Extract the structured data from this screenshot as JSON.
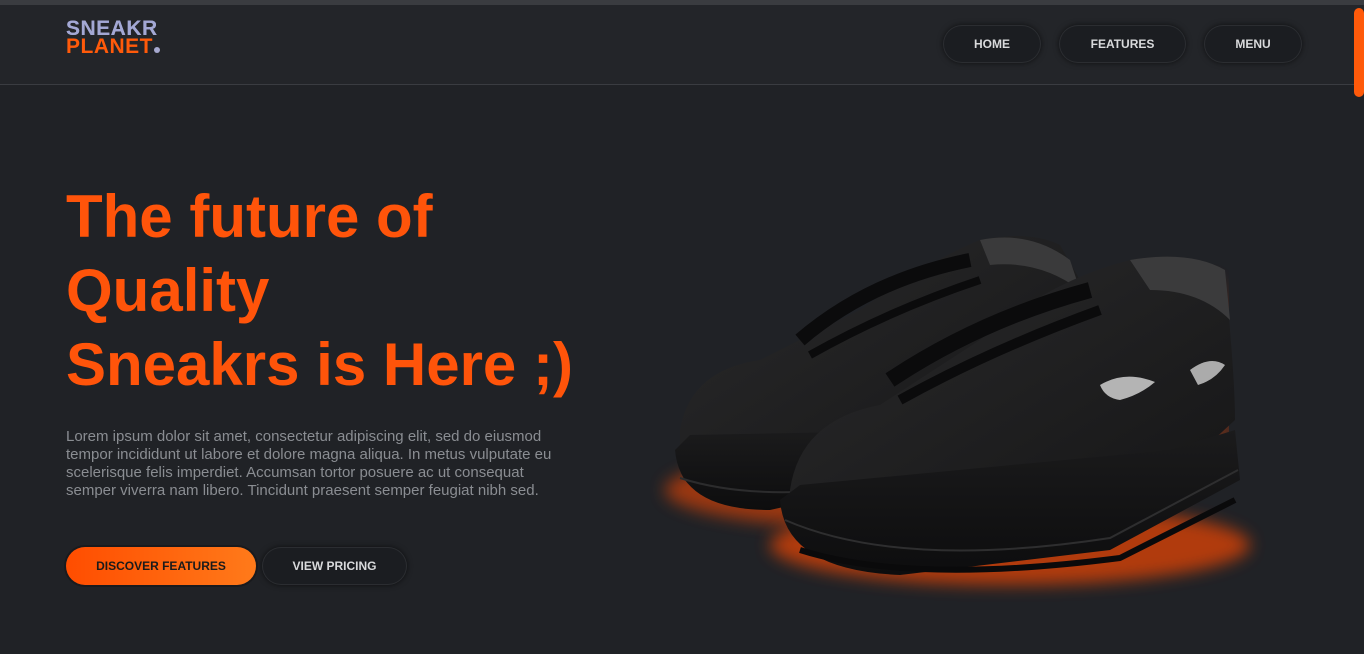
{
  "brand": {
    "line1": "SNEAKR",
    "line2": "PLANET",
    "logo_mark_color": "#a6a9cf"
  },
  "nav": {
    "items": [
      {
        "label": "HOME"
      },
      {
        "label": "FEATURES"
      },
      {
        "label": "MENU"
      }
    ]
  },
  "hero": {
    "title_lines": [
      "The future of",
      "Quality",
      "Sneakrs is Here ;)"
    ],
    "text": "Lorem ipsum dolor sit amet, consectetur adipiscing elit, sed do eiusmod tempor incididunt ut labore et dolore magna aliqua. In metus vulputate eu scelerisque felis imperdiet. Accumsan tortor posuere ac ut consequat semper viverra nam libero. Tincidunt praesent semper feugiat nibh sed.",
    "primary_cta": "DISCOVER FEATURES",
    "secondary_cta": "VIEW PRICING"
  },
  "colors": {
    "accent": "#ff540a",
    "background": "#202226",
    "button_dark": "#1b1d21",
    "muted_text": "#8a8d92"
  },
  "icons": {
    "product_image": "black-sneakers-illustration"
  }
}
